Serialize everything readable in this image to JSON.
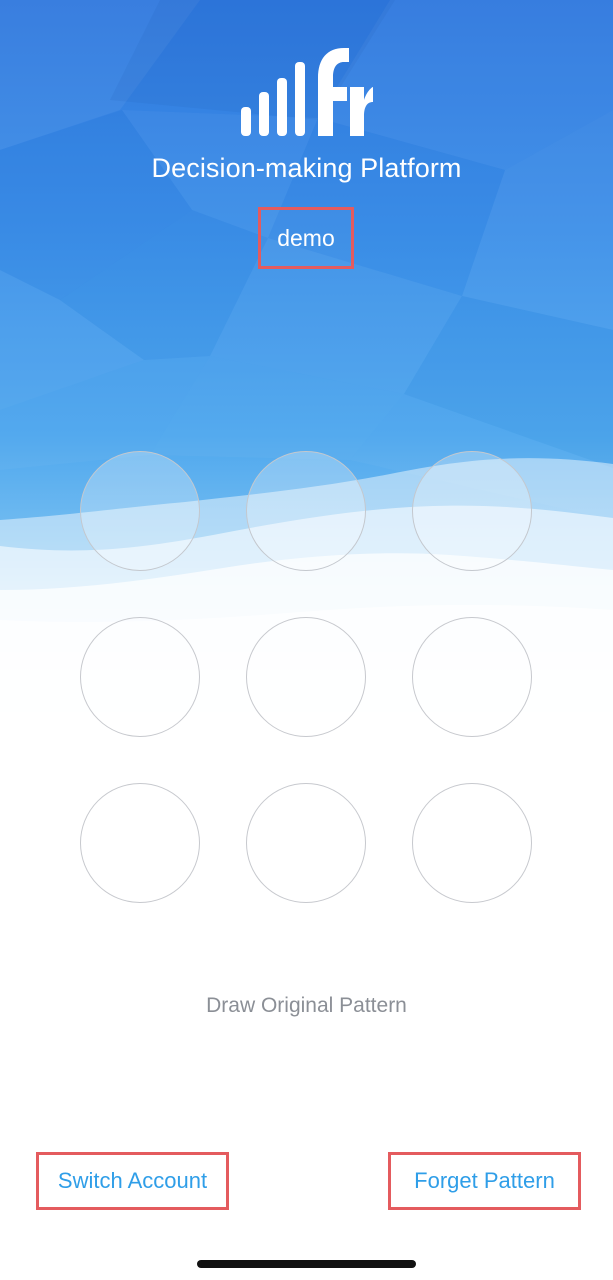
{
  "header": {
    "logo_icon": "brand-logo-icon",
    "title": "Decision-making Platform",
    "account_name": "demo"
  },
  "pattern": {
    "instruction": "Draw Original Pattern",
    "nodes": [
      1,
      2,
      3,
      4,
      5,
      6,
      7,
      8,
      9
    ]
  },
  "footer": {
    "switch_account": "Switch Account",
    "forget_pattern": "Forget Pattern"
  },
  "colors": {
    "top_blue": "#2f78de",
    "mid_blue": "#4ea7ee",
    "link_blue": "#2f9ee8",
    "highlight_red": "#e45b5e",
    "instruction_gray": "#8b8f96",
    "node_border": "#c6c9cf"
  }
}
